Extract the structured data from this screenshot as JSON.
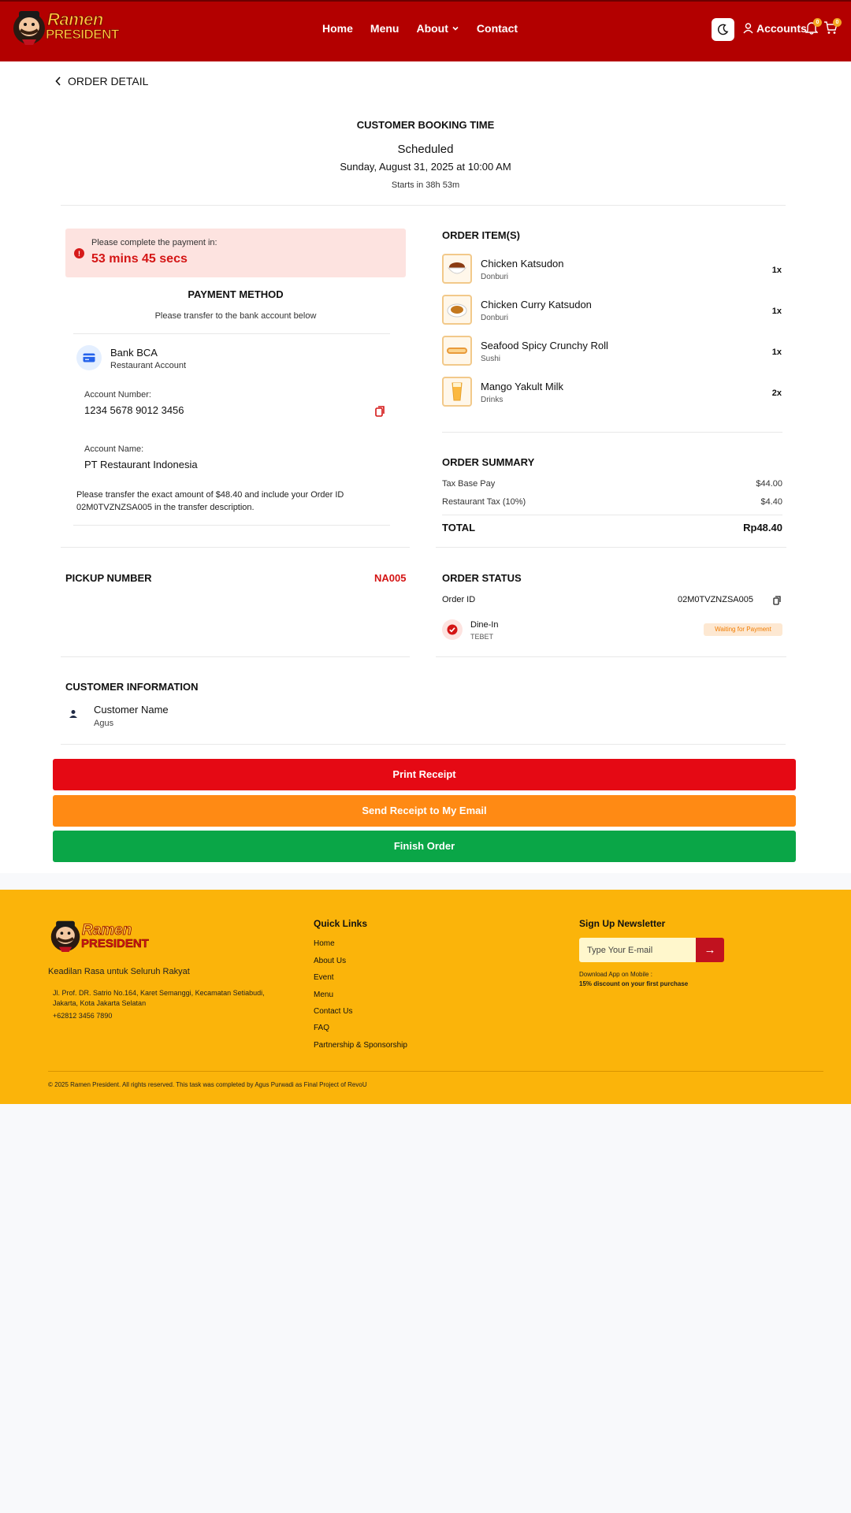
{
  "nav": {
    "brand_line1": "Ramen",
    "brand_line2": "PRESIDENT",
    "links": [
      "Home",
      "Menu",
      "About",
      "Contact"
    ],
    "accounts": "Accounts",
    "notification_count": "0",
    "cart_count": "0"
  },
  "page": {
    "back_label": "ORDER DETAIL"
  },
  "booking": {
    "title": "CUSTOMER BOOKING TIME",
    "status": "Scheduled",
    "date": "Sunday, August 31, 2025 at 10:00 AM",
    "starts": "Starts in 38h 53m"
  },
  "payment": {
    "alert_label": "Please complete the payment in:",
    "countdown": "53 mins 45 secs",
    "method_title": "PAYMENT METHOD",
    "method_sub": "Please transfer to the bank account below",
    "bank_name": "Bank BCA",
    "bank_sub": "Restaurant Account",
    "account_number_label": "Account Number:",
    "account_number": "1234 5678 9012 3456",
    "account_name_label": "Account Name:",
    "account_name": "PT Restaurant Indonesia",
    "note": "Please transfer the exact amount of $48.40 and include your Order ID 02M0TVZNZSA005 in the transfer description."
  },
  "pickup": {
    "label": "PICKUP NUMBER",
    "value": "NA005"
  },
  "order_items": {
    "title": "ORDER ITEM(S)",
    "items": [
      {
        "name": "Chicken Katsudon",
        "category": "Donburi",
        "qty": "1x"
      },
      {
        "name": "Chicken Curry Katsudon",
        "category": "Donburi",
        "qty": "1x"
      },
      {
        "name": "Seafood Spicy Crunchy Roll",
        "category": "Sushi",
        "qty": "1x"
      },
      {
        "name": "Mango Yakult Milk",
        "category": "Drinks",
        "qty": "2x"
      }
    ]
  },
  "summary": {
    "title": "ORDER SUMMARY",
    "rows": [
      {
        "label": "Tax Base Pay",
        "value": "$44.00"
      },
      {
        "label": "Restaurant Tax (10%)",
        "value": "$4.40"
      }
    ],
    "total_label": "TOTAL",
    "total_value": "Rp48.40"
  },
  "status": {
    "title": "ORDER STATUS",
    "order_id_label": "Order ID",
    "order_id": "02M0TVZNZSA005",
    "dine_label": "Dine-In",
    "dine_sub": "TEBET",
    "badge": "Waiting for Payment",
    "colors": {
      "badge_text": "#f07c00",
      "badge_bg": "#fde8d2"
    }
  },
  "customer": {
    "title": "CUSTOMER INFORMATION",
    "label": "Customer Name",
    "name": "Agus"
  },
  "actions": {
    "print": "Print Receipt",
    "send": "Send Receipt to My Email",
    "finish": "Finish Order"
  },
  "footer": {
    "tagline": "Keadilan Rasa untuk Seluruh Rakyat",
    "address": "Jl. Prof. DR. Satrio No.164, Karet Semanggi, Kecamatan Setiabudi, Jakarta, Kota Jakarta Selatan",
    "phone": "+62812 3456 7890",
    "quick_links_title": "Quick Links",
    "quick_links": [
      "Home",
      "About Us",
      "Event",
      "Menu",
      "Contact Us",
      "FAQ",
      "Partnership & Sponsorship"
    ],
    "newsletter_title": "Sign Up Newsletter",
    "newsletter_placeholder": "Type Your E-mail",
    "download_text": "Download App on Mobile :",
    "discount_text": "15% discount on your first purchase",
    "copyright": "© 2025 Ramen President. All rights reserved. This task was completed by Agus Purwadi as Final Project of RevoU"
  },
  "colors": {
    "navbar": "#b30000",
    "brand_yellow": "#fbb40a",
    "print_button": "#e50914",
    "send_button": "#ff8a14",
    "finish_button": "#0aa647",
    "accent_red": "#d41515"
  }
}
